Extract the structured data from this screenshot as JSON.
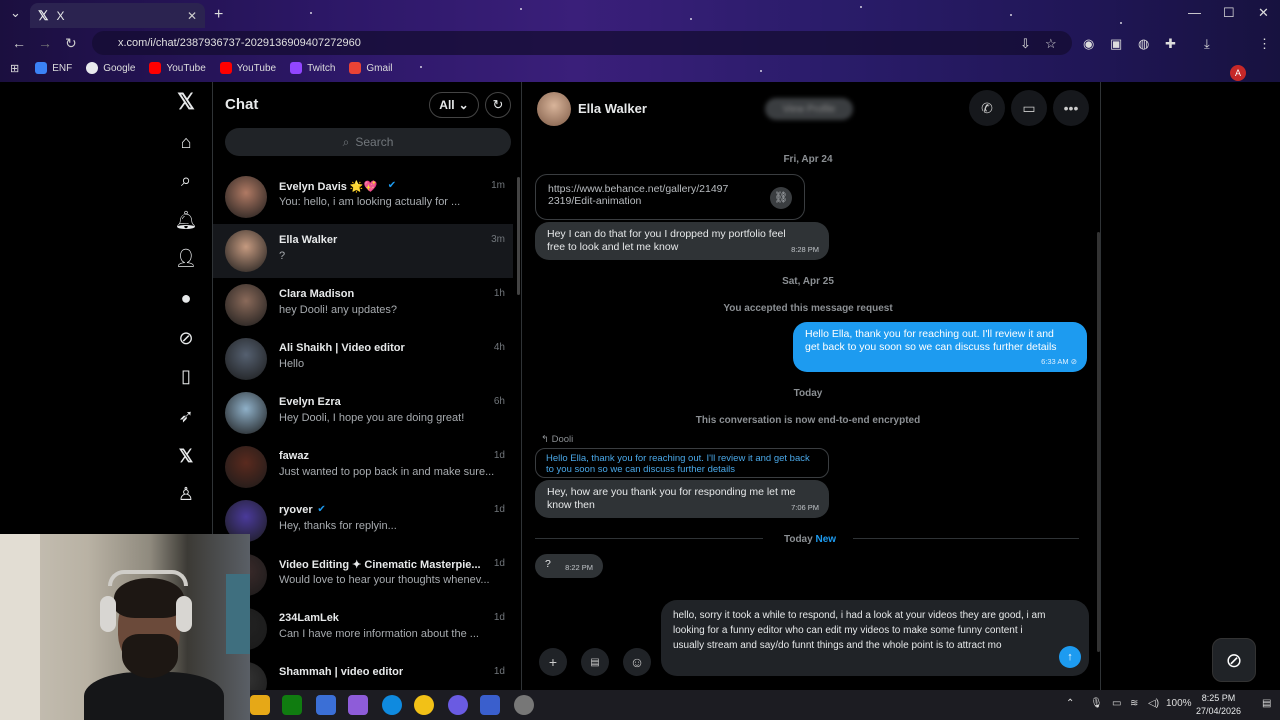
{
  "browser": {
    "tab_title": "X",
    "url": "x.com/i/chat/2387936737-2029136909407272960",
    "bookmarks": [
      {
        "label": "ENF",
        "color": "#3b82f6"
      },
      {
        "label": "Google",
        "color": "#e8eaed"
      },
      {
        "label": "YouTube",
        "color": "#ff0000"
      },
      {
        "label": "YouTube",
        "color": "#ff0000"
      },
      {
        "label": "Twitch",
        "color": "#9146ff"
      },
      {
        "label": "Gmail",
        "color": "#ea4335"
      }
    ]
  },
  "sidebar_nav": [
    "x-logo",
    "home-icon",
    "search-icon",
    "bell-icon",
    "add-person-icon",
    "chat-icon",
    "grok-icon",
    "bookmark-icon",
    "rocket-icon",
    "x-premium-icon",
    "profile-icon"
  ],
  "chat_list": {
    "title": "Chat",
    "filter": "All",
    "search_placeholder": "Search",
    "conversations": [
      {
        "name": "Evelyn Davis 🌟💖",
        "verified": true,
        "time": "1m",
        "preview": "You: hello, i am looking actually for ...",
        "color": "#b07a64"
      },
      {
        "name": "Ella Walker",
        "verified": false,
        "time": "3m",
        "preview": "?",
        "color": "#c59a80"
      },
      {
        "name": "Clara Madison",
        "verified": false,
        "time": "1h",
        "preview": "hey Dooli! any updates?",
        "color": "#8a6a5a"
      },
      {
        "name": "Ali Shaikh | Video editor",
        "verified": false,
        "time": "4h",
        "preview": "Hello",
        "color": "#556070"
      },
      {
        "name": "Evelyn Ezra",
        "verified": false,
        "time": "6h",
        "preview": "Hey Dooli, I hope you are doing great!",
        "color": "#8fb0c8"
      },
      {
        "name": "fawaz",
        "verified": false,
        "time": "1d",
        "preview": "Just wanted to pop back in and make sure...",
        "color": "#5a2a1e"
      },
      {
        "name": "ryover",
        "verified": true,
        "time": "1d",
        "preview": "Hey, thanks for replyin...",
        "color": "#4a3a9a"
      },
      {
        "name": "Video Editing ✦ Cinematic Masterpie...",
        "verified": false,
        "time": "1d",
        "preview": "Would love to hear your thoughts whenev...",
        "color": "#3a2a2a"
      },
      {
        "name": "234LamLek",
        "verified": false,
        "time": "1d",
        "preview": "Can I have more information about the ...",
        "color": "#222"
      },
      {
        "name": "Shammah | video editor",
        "verified": false,
        "time": "1d",
        "preview": "",
        "color": "#333"
      }
    ]
  },
  "conversation": {
    "contact_name": "Ella Walker",
    "header_button": "View Profile",
    "date_1": "Fri, Apr 24",
    "link_url": "https://www.behance.net/gallery/21497 2319/Edit-animation",
    "msg_1": "Hey I can do that for you  I dropped my portfolio feel free to look and let me know",
    "msg_1_time": "8:28 PM",
    "date_2": "Sat, Apr 25",
    "accepted": "You accepted this message request",
    "msg_2": "Hello Ella, thank you for reaching out.  I'll review it and get back to you soon so we can discuss further details",
    "msg_2_time": "6:33 AM ⊘",
    "date_3": "Today",
    "encrypted": "This conversation is now end-to-end encrypted",
    "reply_to": "↰ Dooli",
    "reply_quote": "Hello Ella, thank you for reaching out.  I'll review it and get back to you soon so we can discuss further details",
    "msg_3": "Hey, how are you thank you for responding me let me know then",
    "msg_3_time": "7:06 PM",
    "today_label": "Today",
    "new_label": "New",
    "msg_4": "?",
    "msg_4_time": "8:22 PM",
    "compose_text": "hello, sorry it took a while to respond, i had a look at your videos they are good, i am looking for a funny editor who can edit my videos to make some funny content i usually stream and say/do funnt things and the whole point is to attract mo"
  },
  "taskbar": {
    "battery": "100%",
    "time": "8:25 PM",
    "date": "27/04/2026"
  }
}
